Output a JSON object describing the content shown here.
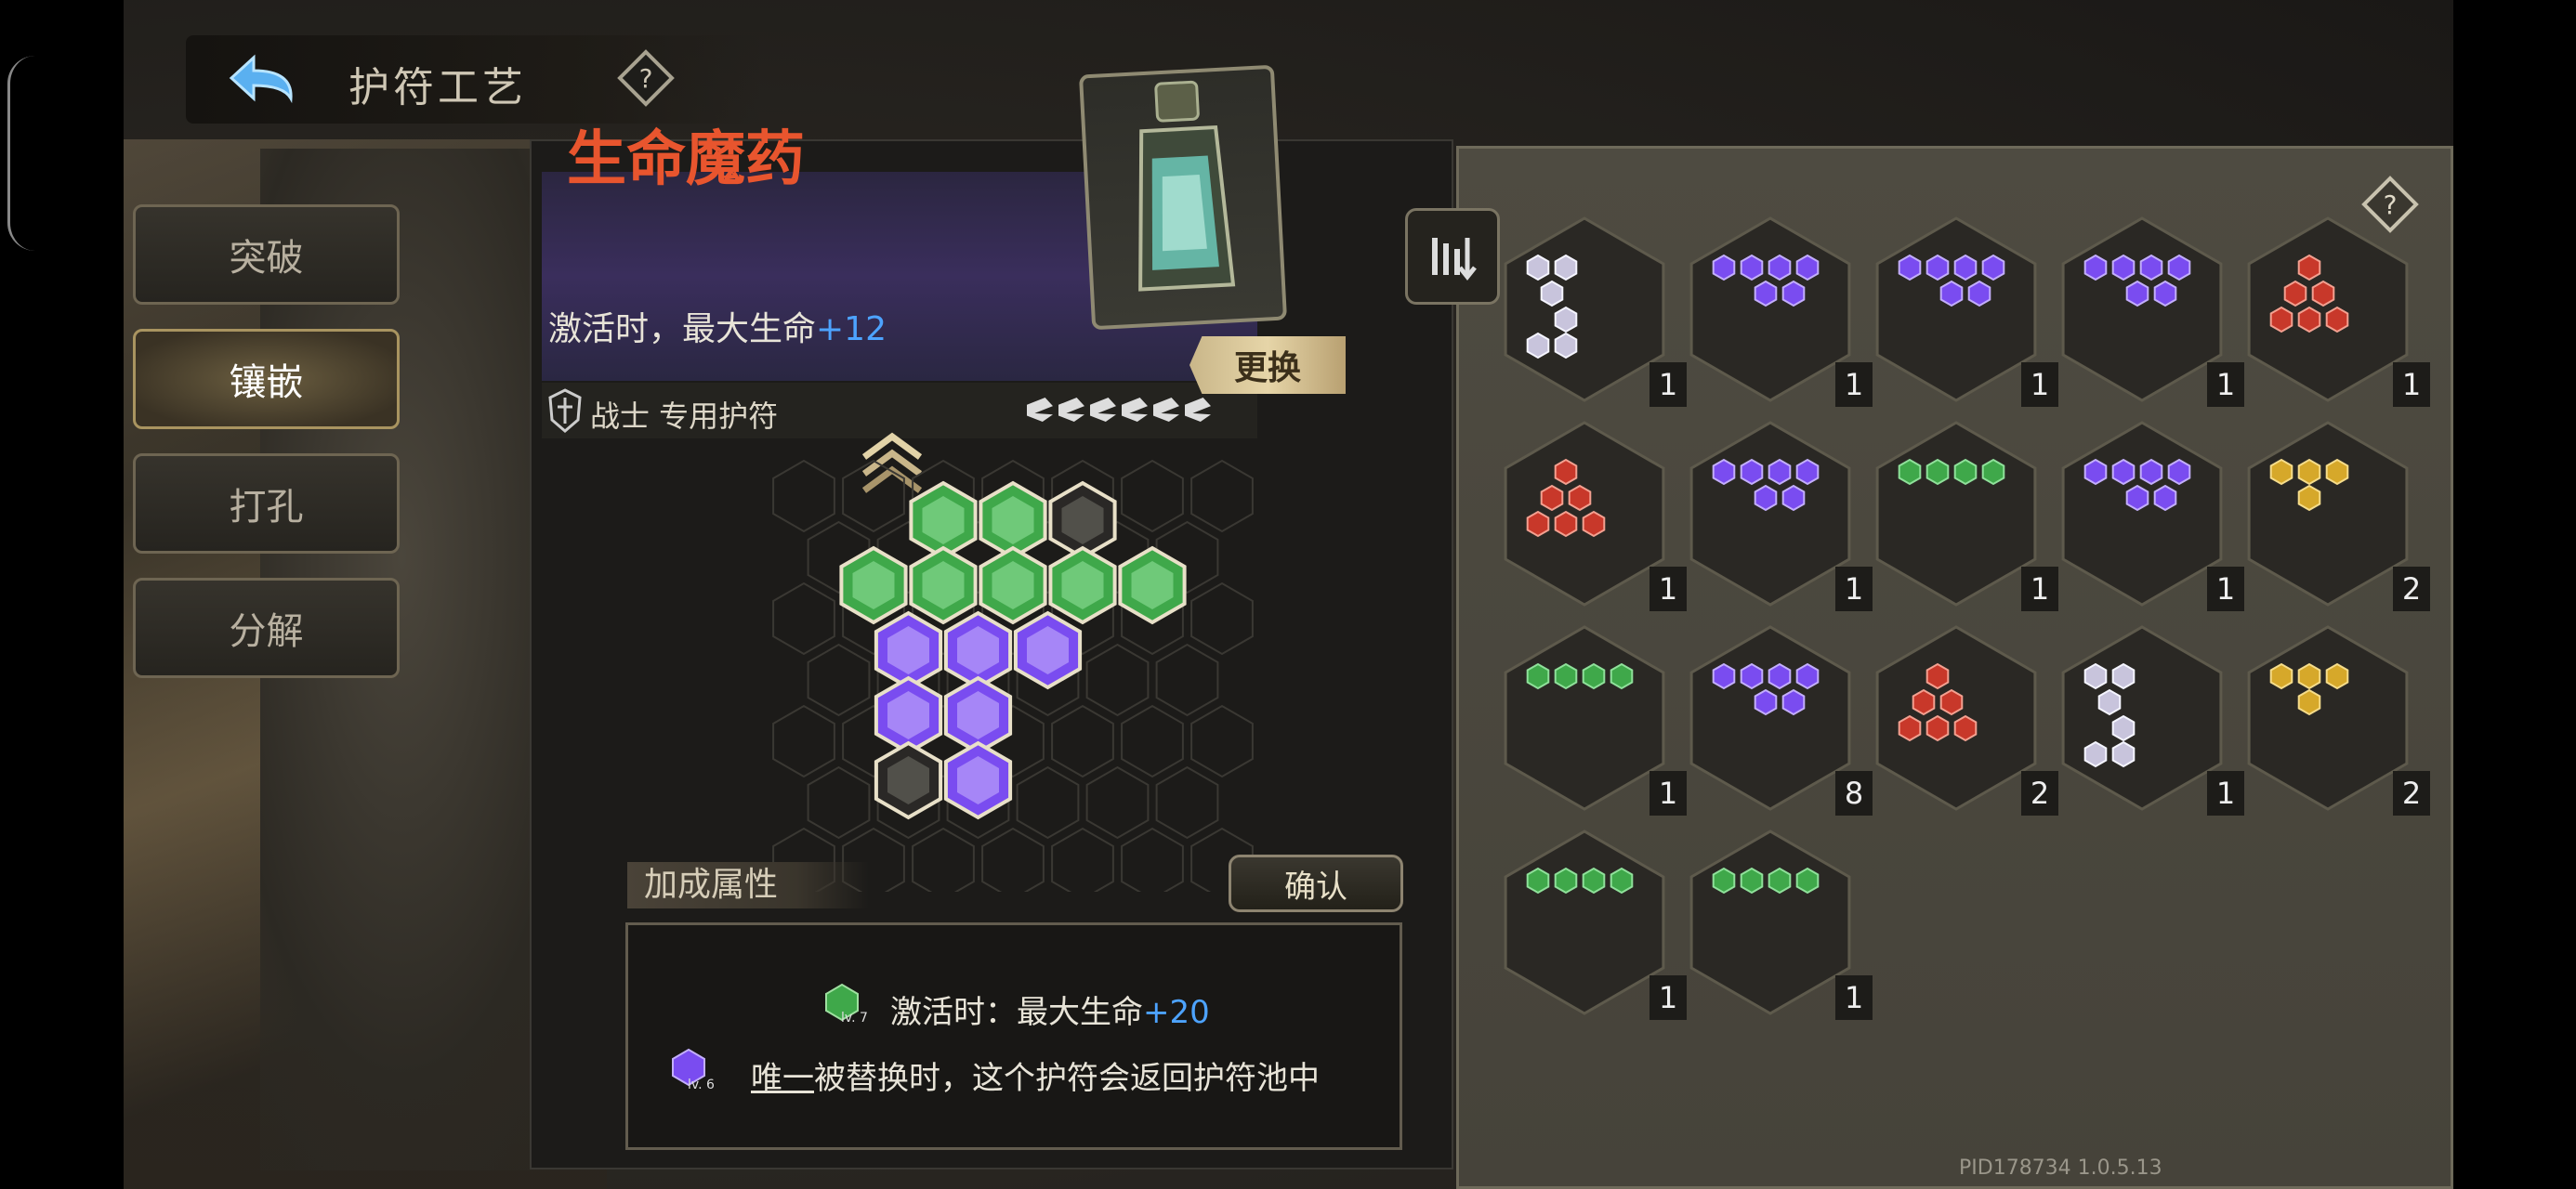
{
  "header": {
    "title": "护符工艺",
    "back_icon": "back-arrow-icon",
    "help_icon": "help-diamond-icon"
  },
  "tabs": [
    {
      "label": "突破",
      "active": false
    },
    {
      "label": "镶嵌",
      "active": true
    },
    {
      "label": "打孔",
      "active": false
    },
    {
      "label": "分解",
      "active": false
    }
  ],
  "charm": {
    "name": "生命魔药",
    "effect_prefix": "激活时，最大生命",
    "effect_value": "+12",
    "class_label": "战士 专用护符",
    "swap_label": "更换",
    "rank_count": 6
  },
  "board": {
    "rows": [
      [
        "green",
        "green",
        "white"
      ],
      [
        "green",
        "green",
        "green",
        "green",
        "green"
      ],
      [
        "purple",
        "purple",
        "purple"
      ],
      [
        "purple",
        "purple"
      ],
      [
        "white",
        "purple"
      ]
    ]
  },
  "bonus": {
    "title": "加成属性",
    "confirm_label": "确认",
    "line1_prefix": "激活时：最大生命",
    "line1_value": "+20",
    "line1_level": "lv. 7",
    "line2_link": "唯一",
    "line2_rest": "被替换时，这个护符会返回护符池中",
    "line2_level": "lv. 6"
  },
  "inventory": {
    "items": [
      {
        "color": "white",
        "count": "1"
      },
      {
        "color": "purple",
        "count": "1"
      },
      {
        "color": "purple",
        "count": "1"
      },
      {
        "color": "purple",
        "count": "1"
      },
      {
        "color": "red",
        "count": "1"
      },
      {
        "color": "red",
        "count": "1"
      },
      {
        "color": "purple",
        "count": "1"
      },
      {
        "color": "green",
        "count": "1"
      },
      {
        "color": "purple",
        "count": "1"
      },
      {
        "color": "yellow",
        "count": "2"
      },
      {
        "color": "green",
        "count": "1"
      },
      {
        "color": "purple",
        "count": "8"
      },
      {
        "color": "red",
        "count": "2"
      },
      {
        "color": "white",
        "count": "1"
      },
      {
        "color": "yellow",
        "count": "2"
      },
      {
        "color": "green",
        "count": "1"
      },
      {
        "color": "green",
        "count": "1"
      }
    ]
  },
  "colors": {
    "green": "#3fa84a",
    "purple": "#7a4cf0",
    "red": "#c8382a",
    "yellow": "#d6a82a",
    "white": "#c8c4dc",
    "accent_orange": "#e8552e",
    "accent_blue": "#4da3ff"
  },
  "footer": {
    "pid": "PID178734  1.0.5.13"
  }
}
